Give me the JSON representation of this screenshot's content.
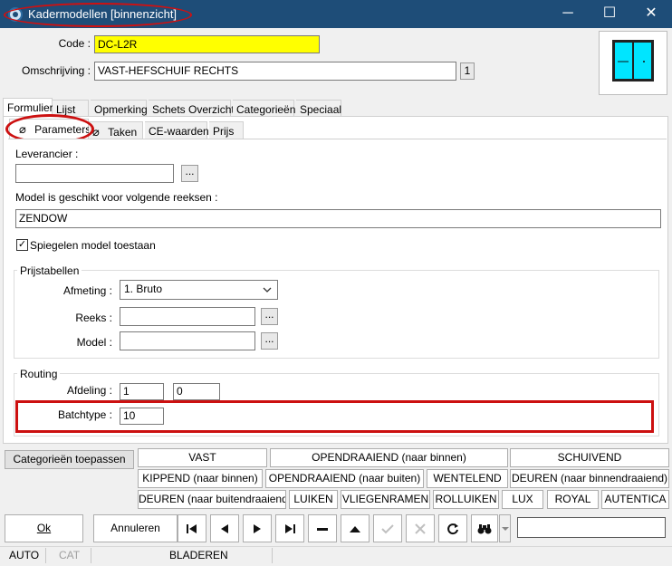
{
  "window": {
    "title": "Kadermodellen [binnenzicht]",
    "minimize": "─",
    "maximize": "☐",
    "close": "✕"
  },
  "header": {
    "code_label": "Code :",
    "code_value": "DC-L2R",
    "omschrijving_label": "Omschrijving :",
    "omschrijving_value": "VAST-HEFSCHUIF RECHTS",
    "counter": "1"
  },
  "main_tabs": [
    "Formulier",
    "Lijst",
    "Opmerking",
    "Schets Overzicht",
    "Categorieën",
    "Speciaal"
  ],
  "sub_tabs": [
    "Parameters",
    "Taken",
    "CE-waarden",
    "Prijs"
  ],
  "parameters": {
    "leverancier_label": "Leverancier :",
    "leverancier_value": "",
    "dots": "...",
    "reeksen_label": "Model is geschikt voor volgende reeksen :",
    "reeksen_value": "ZENDOW",
    "spiegelen_label": "Spiegelen model toestaan",
    "spiegelen_checked": true
  },
  "prijstabellen": {
    "title": "Prijstabellen",
    "afmeting_label": "Afmeting :",
    "afmeting_value": "1.  Bruto",
    "reeks_label": "Reeks :",
    "reeks_value": "",
    "model_label": "Model :",
    "model_value": ""
  },
  "routing": {
    "title": "Routing",
    "afdeling_label": "Afdeling :",
    "afdeling_value1": "1",
    "afdeling_value2": "0",
    "batchtype_label": "Batchtype :",
    "batchtype_value": "10"
  },
  "categories": {
    "apply_label": "Categorieën toepassen",
    "row1": [
      "VAST",
      "OPENDRAAIEND (naar binnen)",
      "SCHUIVEND"
    ],
    "row2": [
      "KIPPEND (naar binnen)",
      "OPENDRAAIEND (naar buiten)",
      "WENTELEND",
      "DEUREN (naar binnendraaiend)"
    ],
    "row3": [
      "DEUREN (naar buitendraaiend)",
      "LUIKEN",
      "VLIEGENRAMEN",
      "ROLLUIKEN",
      "LUX",
      "ROYAL",
      "AUTENTICA"
    ]
  },
  "footer": {
    "ok_label": "Ok",
    "annuleren_label": "Annuleren",
    "search_value": ""
  },
  "statusbar": {
    "mode": "AUTO",
    "cat": "CAT",
    "state": "BLADEREN"
  },
  "colors": {
    "titlebar": "#1e4d78",
    "highlight_red": "#cc1010",
    "code_field": "#ffff00",
    "window_icon": "#00e5ff"
  }
}
